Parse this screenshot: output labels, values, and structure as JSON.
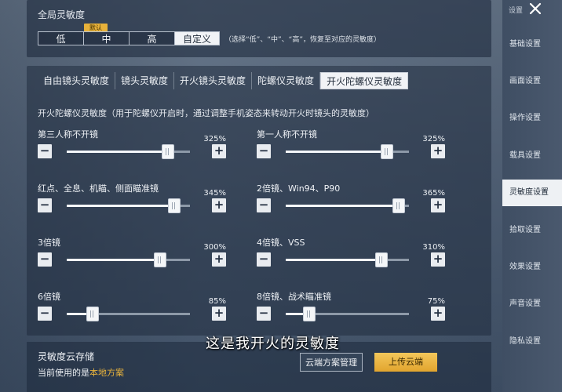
{
  "global": {
    "title": "全局灵敏度",
    "presets": [
      "低",
      "中",
      "高",
      "自定义"
    ],
    "active_preset": "自定义",
    "default_badge": "默认",
    "hint": "（选择“低”、“中”、“高”，恢复至对应的灵敏度）"
  },
  "tabs": [
    "自由镜头灵敏度",
    "镜头灵敏度",
    "开火镜头灵敏度",
    "陀螺仪灵敏度",
    "开火陀螺仪灵敏度"
  ],
  "active_tab": "开火陀螺仪灵敏度",
  "section_desc": "开火陀螺仪灵敏度（用于陀螺仪开启时，通过调整手机姿态来转动开火时镜头的灵敏度）",
  "sliders": [
    {
      "label": "第三人称不开镜",
      "value": "325%",
      "fraction": 0.82
    },
    {
      "label": "第一人称不开镜",
      "value": "325%",
      "fraction": 0.82
    },
    {
      "label": "红点、全息、机瞄、侧面瞄准镜",
      "value": "345%",
      "fraction": 0.87
    },
    {
      "label": "2倍镜、Win94、P90",
      "value": "365%",
      "fraction": 0.92
    },
    {
      "label": "3倍镜",
      "value": "300%",
      "fraction": 0.76
    },
    {
      "label": "4倍镜、VSS",
      "value": "310%",
      "fraction": 0.78
    },
    {
      "label": "6倍镜",
      "value": "85%",
      "fraction": 0.21
    },
    {
      "label": "8倍镜、战术瞄准镜",
      "value": "75%",
      "fraction": 0.19
    }
  ],
  "cloud": {
    "title": "灵敏度云存储",
    "current_prefix": "当前使用的是",
    "current_value": "本地方案",
    "manage_button": "云端方案管理",
    "upload_button": "上传云端"
  },
  "subtitle": "这是我开火的灵敏度",
  "sidebar": {
    "close_label": "设置",
    "items": [
      "基础设置",
      "画面设置",
      "操作设置",
      "载具设置",
      "灵敏度设置",
      "拾取设置",
      "效果设置",
      "声音设置",
      "隐私设置"
    ],
    "active": "灵敏度设置"
  },
  "colors": {
    "accent": "#e7b23c",
    "active_bg": "#eef1f4"
  }
}
